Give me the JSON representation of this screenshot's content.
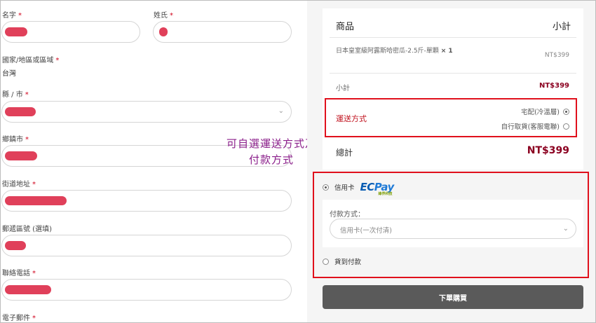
{
  "form": {
    "first_name": {
      "label": "名字",
      "required": "*"
    },
    "last_name": {
      "label": "姓氏",
      "required": "*"
    },
    "country": {
      "label": "國家/地區或區域",
      "required": "*",
      "value": "台灣"
    },
    "county": {
      "label": "縣 / 市",
      "required": "*",
      "dropdown_icon": "chevron-down-icon"
    },
    "township": {
      "label": "鄉鎮市",
      "required": "*"
    },
    "address": {
      "label": "街道地址",
      "required": "*"
    },
    "postcode": {
      "label": "郵遞區號 (選填)"
    },
    "phone": {
      "label": "聯絡電話",
      "required": "*"
    },
    "email": {
      "label": "電子郵件",
      "required": "*"
    }
  },
  "summary": {
    "header_product": "商品",
    "header_subtotal": "小計",
    "item_name": "日本皇室級阿露斯哈密瓜-2.5斤-單顆",
    "item_qty": "× 1",
    "item_price": "NT$399",
    "subtotal_label": "小計",
    "subtotal_value": "NT$399",
    "shipping_label": "運送方式",
    "shipping_options": [
      {
        "label": "宅配(冷溫層)",
        "selected": true
      },
      {
        "label": "自行取貨(客服電聯)",
        "selected": false
      }
    ],
    "total_label": "總計",
    "total_value": "NT$399"
  },
  "payment": {
    "credit_card_label": "信用卡",
    "credit_card_selected": true,
    "ecpay_logo_ec": "EC",
    "ecpay_logo_pay": "Pay",
    "ecpay_logo_sub": "綠界科技",
    "method_label": "付款方式：",
    "method_value": "信用卡(一次付清)",
    "cod_label": "貨到付款",
    "cod_selected": false,
    "submit_label": "下單購買"
  },
  "annotation": {
    "line1": "可自選運送方式及",
    "line2": "付款方式"
  },
  "colors": {
    "required": "#d0021b",
    "highlight_border": "#e0101c",
    "price": "#8b0020",
    "annotation": "#8a1d8a",
    "redaction": "#e0405a",
    "submit_bg": "#5a5a5a"
  }
}
